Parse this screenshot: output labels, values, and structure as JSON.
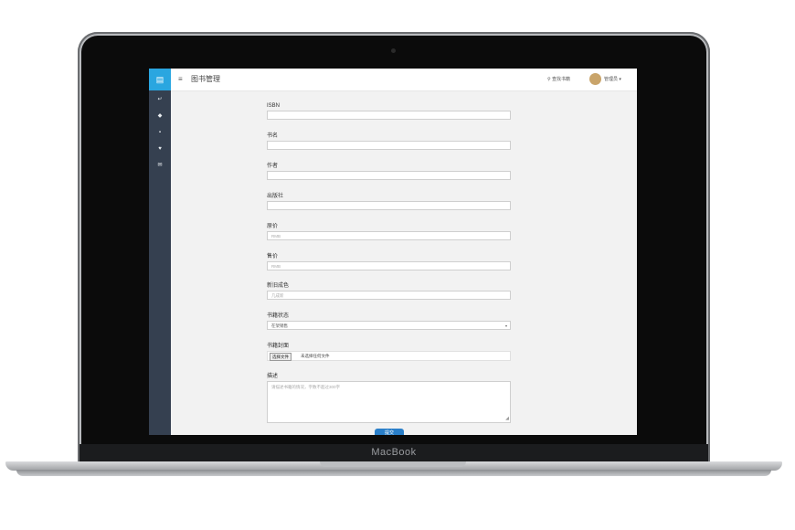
{
  "device": {
    "brand": "MacBook"
  },
  "sidebar": {
    "top_icon": "book-icon",
    "items": [
      {
        "icon": "arrow-in-icon",
        "glyph": "↵"
      },
      {
        "icon": "tag-icon",
        "glyph": "◆"
      },
      {
        "icon": "document-icon",
        "glyph": "▪"
      },
      {
        "icon": "heart-icon",
        "glyph": "♥"
      },
      {
        "icon": "envelope-icon",
        "glyph": "✉"
      }
    ]
  },
  "topbar": {
    "menu_icon": "≡",
    "title": "图书管理",
    "search_link": "⚲ 查找书籍",
    "user_name": "管理员 ▾"
  },
  "form": {
    "isbn": {
      "label": "ISBN",
      "value": ""
    },
    "book_name": {
      "label": "书名",
      "value": ""
    },
    "author": {
      "label": "作者",
      "value": ""
    },
    "publisher": {
      "label": "出版社",
      "value": ""
    },
    "price": {
      "label": "原价",
      "placeholder": "RMB"
    },
    "sell_price": {
      "label": "售价",
      "placeholder": "RMB"
    },
    "quality": {
      "label": "新旧成色",
      "placeholder": "几成新"
    },
    "status": {
      "label": "书籍状态",
      "selected": "在架销售",
      "arrow": "▾"
    },
    "cover": {
      "label": "书籍封面",
      "button": "选择文件",
      "file_text": "未选择任何文件"
    },
    "notes": {
      "label": "描述",
      "placeholder": "请描述书籍的情况，字数不超过300字"
    },
    "submit_label": "提交"
  }
}
